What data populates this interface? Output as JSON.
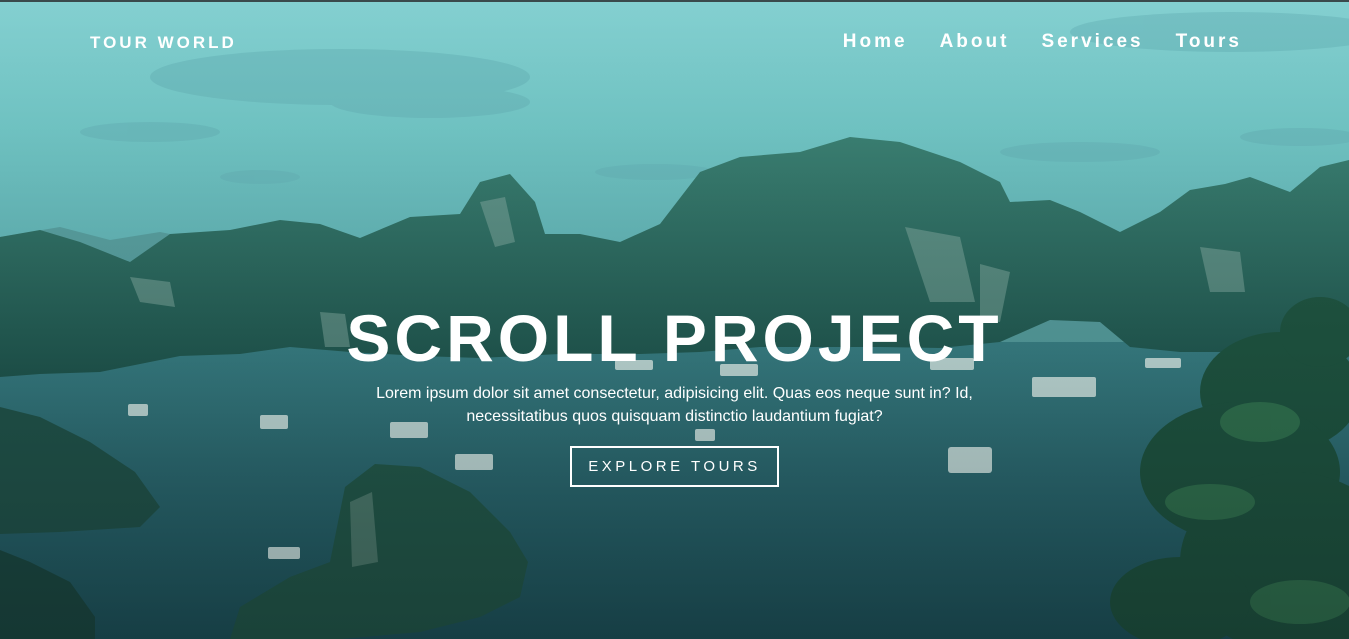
{
  "nav": {
    "brand": "TOUR WORLD",
    "links": [
      {
        "label": "Home"
      },
      {
        "label": "About"
      },
      {
        "label": "Services"
      },
      {
        "label": "Tours"
      }
    ]
  },
  "banner": {
    "title": "SCROLL PROJECT",
    "text": "Lorem ipsum dolor sit amet consectetur, adipisicing elit. Quas eos neque sunt in? Id, necessitatibus quos quisquam distinctio laudantium fugiat?",
    "button_label": "EXPLORE TOURS"
  },
  "colors": {
    "sky": "#8fd7d8",
    "water": "#2e6a70",
    "karst": "#2b5e4e",
    "text": "#ffffff"
  }
}
